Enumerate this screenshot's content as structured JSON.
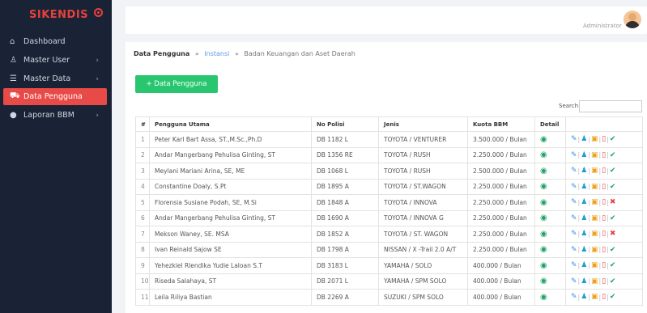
{
  "app": {
    "brand": "SIKENDIS"
  },
  "topbar": {
    "admin_label": "Administrator"
  },
  "sidebar": {
    "items": [
      {
        "label": "Dashboard",
        "icon": "home-icon",
        "chevron": ""
      },
      {
        "label": "Master User",
        "icon": "user-icon",
        "chevron": "›"
      },
      {
        "label": "Master Data",
        "icon": "list-icon",
        "chevron": "›"
      },
      {
        "label": "Data Pengguna",
        "icon": "car-icon",
        "chevron": ""
      },
      {
        "label": "Laporan BBM",
        "icon": "fuel-drop-icon",
        "chevron": "›"
      }
    ]
  },
  "breadcrumb": {
    "item1": "Data Pengguna",
    "sep": "»",
    "item2": "Instansi",
    "item3": "Badan Keuangan dan Aset Daerah"
  },
  "actions": {
    "add_label": "+ Data Pengguna"
  },
  "search": {
    "label": "Search:",
    "value": ""
  },
  "table": {
    "headers": [
      "#",
      "Pengguna Utama",
      "No Polisi",
      "Jenis",
      "Kuota BBM",
      "Detail",
      ""
    ],
    "rows": [
      {
        "no": "1",
        "name": "Peter Karl Bart Assa, ST.,M.Sc.,Ph.D",
        "plate": "DB 1182 L",
        "type": "TOYOTA / VENTURER",
        "quota": "3.500.000 / Bulan",
        "status": "ok"
      },
      {
        "no": "2",
        "name": "Andar Mangerbang Pehulisa Ginting, ST",
        "plate": "DB 1356 RE",
        "type": "TOYOTA / RUSH",
        "quota": "2.250.000 / Bulan",
        "status": "ok"
      },
      {
        "no": "3",
        "name": "Meylani Mariani Arina, SE, ME",
        "plate": "DB 1068 L",
        "type": "TOYOTA / RUSH",
        "quota": "2.500.000 / Bulan",
        "status": "ok"
      },
      {
        "no": "4",
        "name": "Constantine Doaly, S.Pt",
        "plate": "DB 1895 A",
        "type": "TOYOTA / ST.WAGON",
        "quota": "2.250.000 / Bulan",
        "status": "ok"
      },
      {
        "no": "5",
        "name": "Florensia Susiane Podah, SE, M.Si",
        "plate": "DB 1848 A",
        "type": "TOYOTA / INNOVA",
        "quota": "2.250.000 / Bulan",
        "status": "x"
      },
      {
        "no": "6",
        "name": "Andar Mangerbang Pehulisa Ginting, ST",
        "plate": "DB 1690 A",
        "type": "TOYOTA / INNOVA G",
        "quota": "2.250.000 / Bulan",
        "status": "ok"
      },
      {
        "no": "7",
        "name": "Mekson Waney, SE. MSA",
        "plate": "DB 1852 A",
        "type": "TOYOTA / ST. WAGON",
        "quota": "2.250.000 / Bulan",
        "status": "x"
      },
      {
        "no": "8",
        "name": "Ivan Reinald Sajow SE",
        "plate": "DB 1798 A",
        "type": "NISSAN / X -Trail 2.0 A/T",
        "quota": "2.250.000 / Bulan",
        "status": "ok"
      },
      {
        "no": "9",
        "name": "Yehezkiel Rlendika Yudie Laloan S.T",
        "plate": "DB 3183 L",
        "type": "YAMAHA / SOLO",
        "quota": "400.000 / Bulan",
        "status": "ok"
      },
      {
        "no": "10",
        "name": "Riseda Salahaya, ST",
        "plate": "DB 2071 L",
        "type": "YAMAHA / SPM SOLO",
        "quota": "400.000 / Bulan",
        "status": "ok"
      },
      {
        "no": "11",
        "name": "Leila Riliya Bastian",
        "plate": "DB 2269 A",
        "type": "SUZUKI / SPM SOLO",
        "quota": "400.000 / Bulan",
        "status": "ok"
      }
    ]
  },
  "colors": {
    "sidebar_bg": "#1a2335",
    "brand_red": "#e8413b",
    "active_item": "#e84a47",
    "add_button": "#28c76f"
  }
}
